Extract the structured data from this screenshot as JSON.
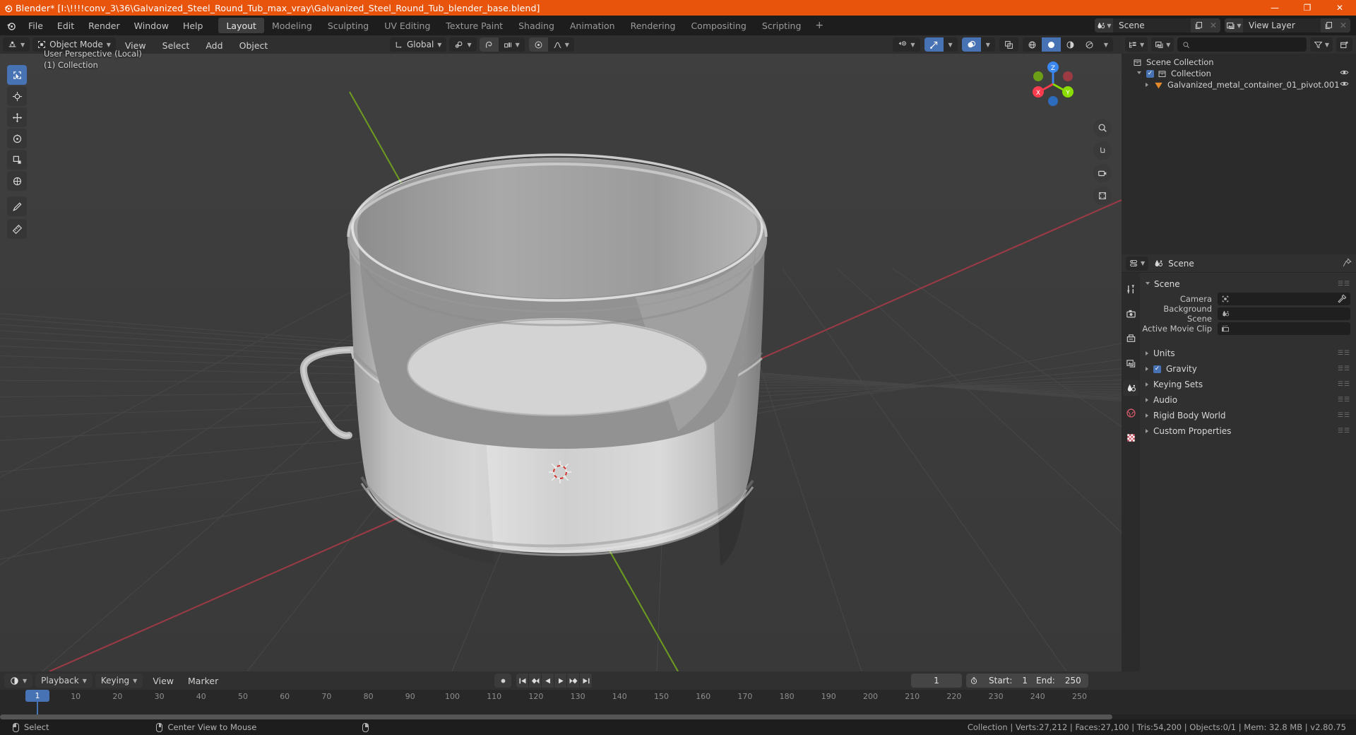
{
  "titlebar": {
    "text": "Blender* [I:\\!!!!conv_3\\36\\Galvanized_Steel_Round_Tub_max_vray\\Galvanized_Steel_Round_Tub_blender_base.blend]",
    "minimize": "—",
    "maximize": "❐",
    "close": "✕",
    "accent": "#e8540c"
  },
  "topbar": {
    "menus": [
      "File",
      "Edit",
      "Render",
      "Window",
      "Help"
    ],
    "workspaces": [
      "Layout",
      "Modeling",
      "Sculpting",
      "UV Editing",
      "Texture Paint",
      "Shading",
      "Animation",
      "Rendering",
      "Compositing",
      "Scripting"
    ],
    "active_workspace": "Layout",
    "add_workspace": "+",
    "scene_name": "Scene",
    "view_layer_name": "View Layer"
  },
  "viewport": {
    "mode": "Object Mode",
    "menus": [
      "View",
      "Select",
      "Add",
      "Object"
    ],
    "transform_orientation": "Global",
    "overlay_line1": "User Perspective (Local)",
    "overlay_line2": "(1) Collection",
    "gizmo_axes": [
      "X",
      "Y",
      "Z"
    ],
    "axis_colors": {
      "x": "#fc3b4f",
      "y": "#8bdc00",
      "z": "#3b87f0"
    }
  },
  "outliner": {
    "search_placeholder": "",
    "rows": [
      {
        "label": "Scene Collection",
        "indent": 0,
        "icon": "collection-icon",
        "has_eye": false,
        "has_checkbox": false,
        "has_tri": false
      },
      {
        "label": "Collection",
        "indent": 1,
        "icon": "collection-icon",
        "has_eye": true,
        "has_checkbox": true,
        "has_tri": true
      },
      {
        "label": "Galvanized_metal_container_01_pivot.001",
        "indent": 2,
        "icon": "empty-icon",
        "has_eye": true,
        "has_checkbox": false,
        "has_tri": true
      }
    ]
  },
  "properties": {
    "breadcrumb": "Scene",
    "panel_title": "Scene",
    "fields": [
      {
        "label": "Camera",
        "value": "",
        "icon": "camera-data-icon",
        "eyedropper": true
      },
      {
        "label": "Background Scene",
        "value": "",
        "icon": "scene-icon",
        "eyedropper": false
      },
      {
        "label": "Active Movie Clip",
        "value": "",
        "icon": "clip-icon",
        "eyedropper": false
      }
    ],
    "sections": [
      {
        "label": "Units",
        "checkbox": false
      },
      {
        "label": "Gravity",
        "checkbox": true
      },
      {
        "label": "Keying Sets",
        "checkbox": false
      },
      {
        "label": "Audio",
        "checkbox": false
      },
      {
        "label": "Rigid Body World",
        "checkbox": false
      },
      {
        "label": "Custom Properties",
        "checkbox": false
      }
    ]
  },
  "timeline": {
    "menus": [
      "Playback",
      "Keying",
      "View",
      "Marker"
    ],
    "playback_label": "Playback",
    "keying_label": "Keying",
    "view_label": "View",
    "marker_label": "Marker",
    "current_frame": "1",
    "start_label": "Start:",
    "start_value": "1",
    "end_label": "End:",
    "end_value": "250",
    "ticks": [
      "1",
      "10",
      "20",
      "30",
      "40",
      "50",
      "60",
      "70",
      "80",
      "90",
      "100",
      "110",
      "120",
      "130",
      "140",
      "150",
      "160",
      "170",
      "180",
      "190",
      "200",
      "210",
      "220",
      "230",
      "240",
      "250"
    ]
  },
  "status": {
    "left_action": "Select",
    "mid_action": "Center View to Mouse",
    "stats": "Collection | Verts:27,212 | Faces:27,100 | Tris:54,200 | Objects:0/1 | Mem: 32.8 MB | v2.80.75"
  }
}
